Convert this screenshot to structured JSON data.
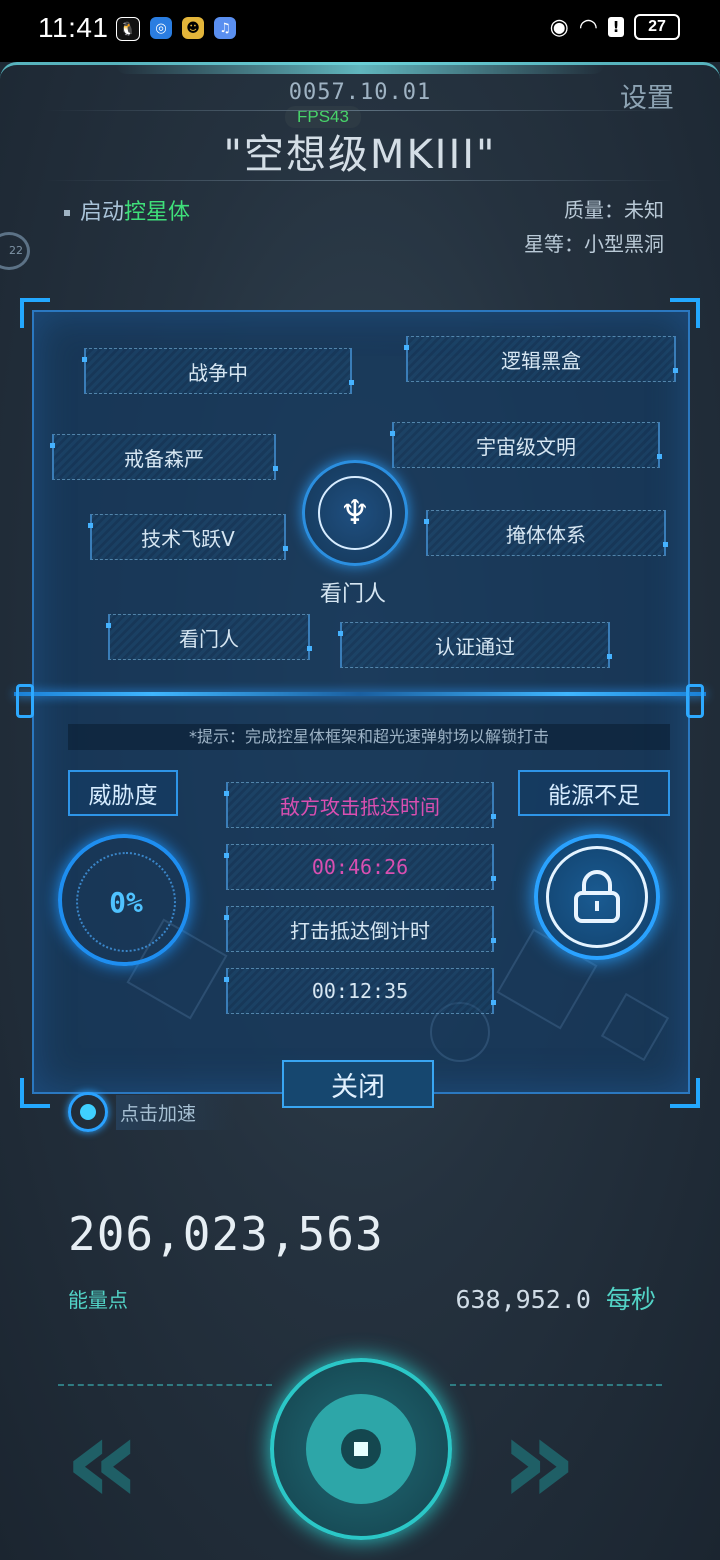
{
  "statusbar": {
    "time": "11:41",
    "apps": [
      "qq-icon",
      "browser-icon",
      "game-icon",
      "music-icon"
    ],
    "battery": "27"
  },
  "header": {
    "date": "0057.10.01",
    "fps": "FPS43",
    "settings_label": "设置",
    "title": "\"空想级MKIII\"",
    "boot_prefix": "启动",
    "boot_highlight": "控星体",
    "mass": "质量：未知",
    "grade": "星等：小型黑洞",
    "side_badge": "22"
  },
  "panel": {
    "tags": [
      "战争中",
      "逻辑黑盒",
      "戒备森严",
      "宇宙级文明",
      "技术飞跃V",
      "掩体体系",
      "看门人",
      "认证通过"
    ],
    "emblem_label": "看门人",
    "hint": "*提示：完成控星体框架和超光速弹射场以解锁打击",
    "threat_label": "威胁度",
    "threat_value": "0%",
    "energy_status": "能源不足",
    "enemy_arrival_label": "敌方攻击抵达时间",
    "enemy_arrival_time": "00:46:26",
    "strike_countdown_label": "打击抵达倒计时",
    "strike_countdown_time": "00:12:35",
    "close_label": "关闭"
  },
  "speed_label": "点击加速",
  "energy": {
    "value": "206,023,563",
    "label": "能量点",
    "rate": "638,952.0",
    "rate_unit": "每秒"
  },
  "colors": {
    "accent": "#2b8fe0",
    "highlight": "#3fe07a",
    "pink": "#d94fb1",
    "teal": "#52d3c6"
  }
}
